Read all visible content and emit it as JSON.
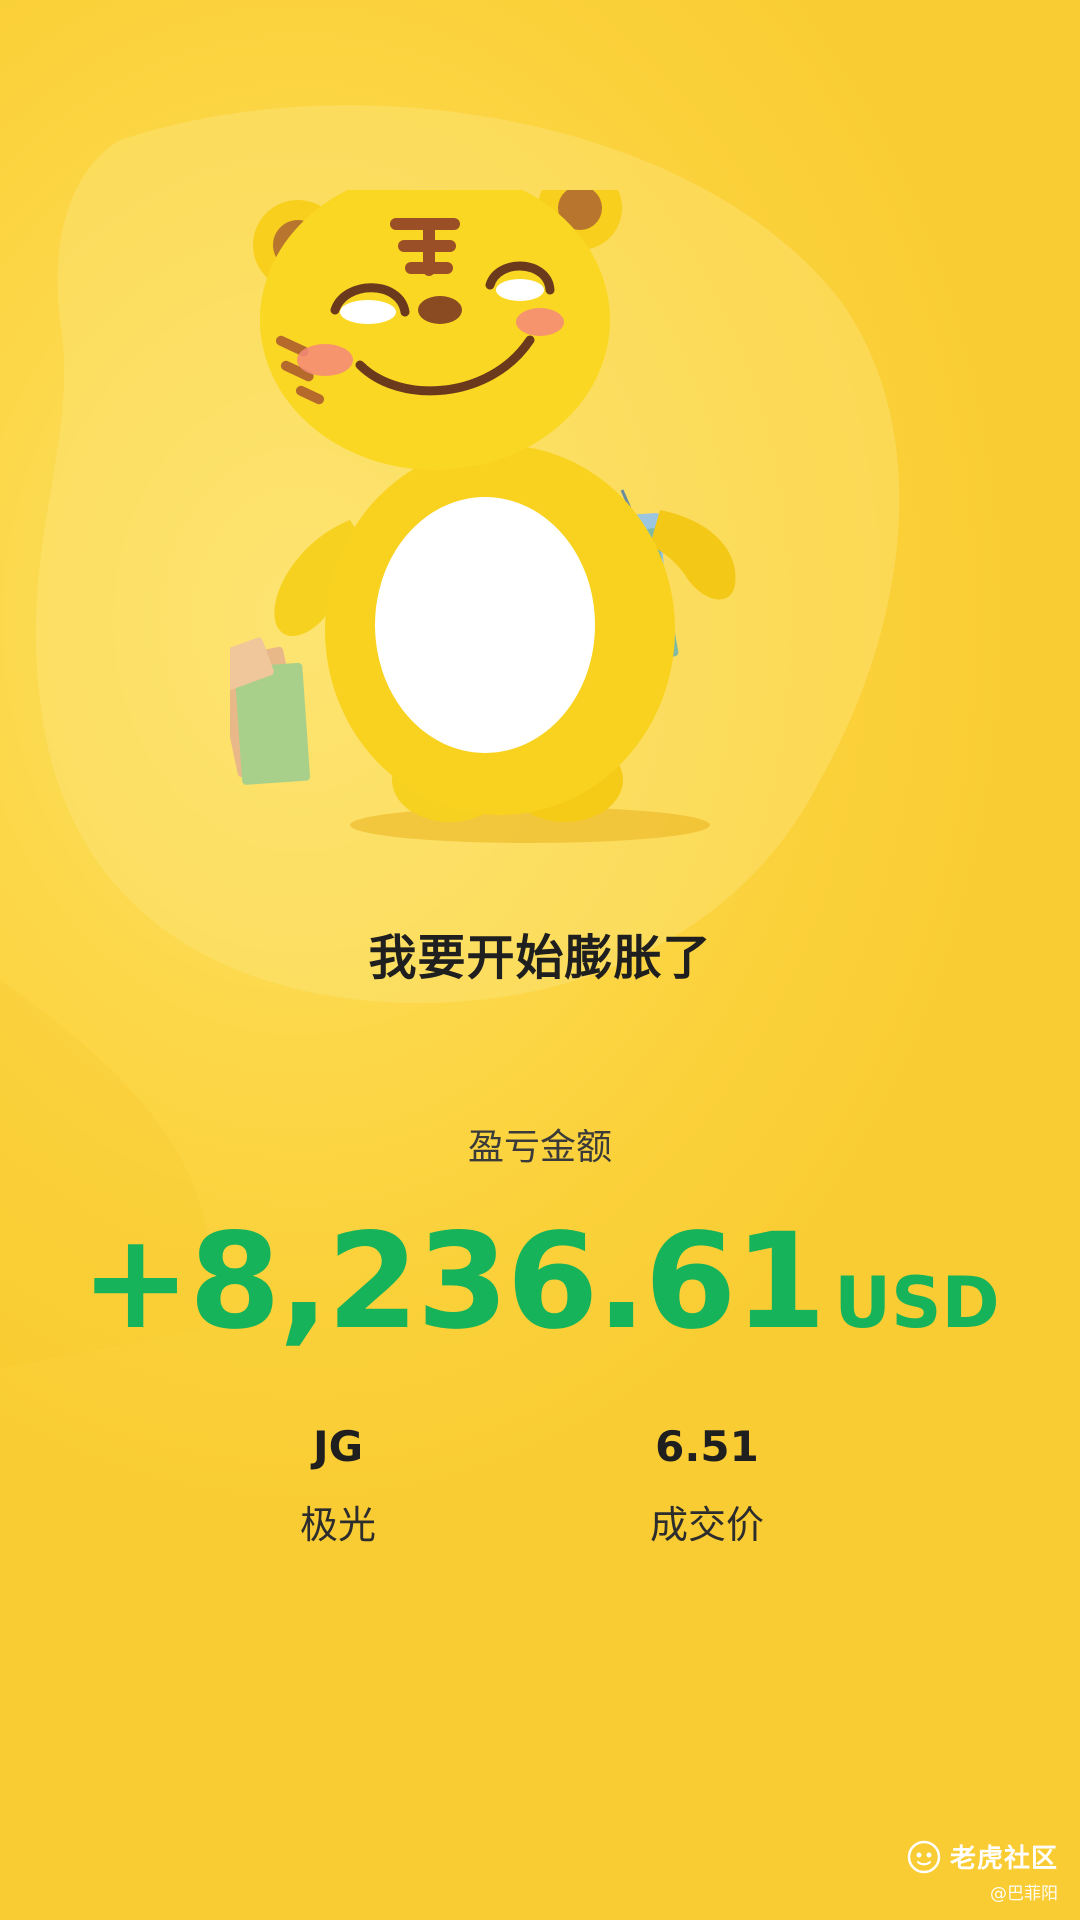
{
  "headline": "我要开始膨胀了",
  "pnl": {
    "label": "盈亏金额",
    "value": "+8,236.61",
    "unit": "USD",
    "color": "#16b35a"
  },
  "stats": {
    "symbol": {
      "value": "JG",
      "label": "极光"
    },
    "price": {
      "value": "6.51",
      "label": "成交价"
    }
  },
  "watermark": {
    "brand": "老虎社区",
    "user": "@巴菲阳",
    "icon": "tiger-logo-icon"
  },
  "mascot": {
    "icon": "tiger-mascot-with-shopping-bags"
  },
  "colors": {
    "background": "#fcd84a",
    "text_dark": "#1f1f1f",
    "profit_green": "#16b35a"
  }
}
